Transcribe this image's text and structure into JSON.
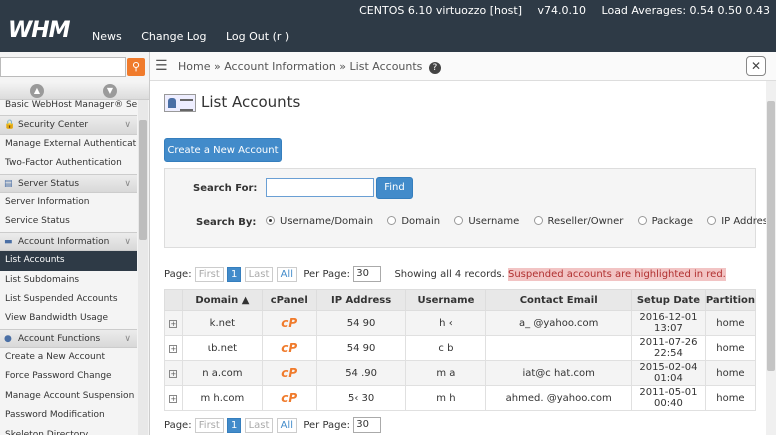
{
  "topbar": {
    "logo": "WHM",
    "nav": [
      "News",
      "Change Log",
      "Log Out (r          )"
    ],
    "server": "CENTOS 6.10 virtuozzo [host]",
    "version": "v74.0.10",
    "load": "Load Averages: 0.54 0.50 0.43"
  },
  "sidebar": {
    "search_placeholder": "",
    "items": [
      {
        "label": "Basic WebHost Manager® Setup",
        "type": "item"
      },
      {
        "label": "Security Center",
        "type": "header",
        "icon": "lock-icon"
      },
      {
        "label": "Manage External Authentications",
        "type": "item"
      },
      {
        "label": "Two-Factor Authentication",
        "type": "item"
      },
      {
        "label": "Server Status",
        "type": "header",
        "icon": "server-icon"
      },
      {
        "label": "Server Information",
        "type": "item"
      },
      {
        "label": "Service Status",
        "type": "item"
      },
      {
        "label": "Account Information",
        "type": "header",
        "icon": "account-icon"
      },
      {
        "label": "List Accounts",
        "type": "item",
        "active": true
      },
      {
        "label": "List Subdomains",
        "type": "item"
      },
      {
        "label": "List Suspended Accounts",
        "type": "item"
      },
      {
        "label": "View Bandwidth Usage",
        "type": "item"
      },
      {
        "label": "Account Functions",
        "type": "header",
        "icon": "users-icon"
      },
      {
        "label": "Create a New Account",
        "type": "item"
      },
      {
        "label": "Force Password Change",
        "type": "item"
      },
      {
        "label": "Manage Account Suspension",
        "type": "item"
      },
      {
        "label": "Password Modification",
        "type": "item"
      },
      {
        "label": "Skeleton Directory",
        "type": "item"
      }
    ]
  },
  "breadcrumb": {
    "home": "Home",
    "section": "Account Information",
    "current": "List Accounts"
  },
  "page": {
    "title": "List Accounts",
    "create_button": "Create a New Account"
  },
  "search": {
    "search_for_label": "Search For:",
    "value": "",
    "find_button": "Find",
    "search_by_label": "Search By:",
    "options": [
      "Username/Domain",
      "Domain",
      "Username",
      "Reseller/Owner",
      "Package",
      "IP Address"
    ],
    "selected": "Username/Domain"
  },
  "pager": {
    "page_label": "Page:",
    "first": "First",
    "current": "1",
    "last": "Last",
    "all": "All",
    "per_page_label": "Per Page:",
    "per_page": "30",
    "showing": "Showing all 4 records.",
    "suspended_note": "Suspended accounts are highlighted in red."
  },
  "table": {
    "columns": [
      "",
      "Domain ▲",
      "cPanel",
      "IP Address",
      "Username",
      "Contact Email",
      "Setup Date",
      "Partition"
    ],
    "rows": [
      {
        "domain": "k.net",
        "ip": "54         90",
        "username": "h    ‹",
        "email": "a_          @yahoo.com",
        "date": "2016-12-01 13:07",
        "partition": "home"
      },
      {
        "domain": "ιb.net",
        "ip": "54         90",
        "username": "c         b",
        "email": "",
        "date": "2011-07-26 22:54",
        "partition": "home"
      },
      {
        "domain": "n         a.com",
        "ip": "54         .90",
        "username": "m         a",
        "email": "       iat@c     hat.com",
        "date": "2015-02-04 01:04",
        "partition": "home"
      },
      {
        "domain": "m          h.com",
        "ip": "5‹         30",
        "username": "m         h",
        "email": "ahmed.                @yahoo.com",
        "date": "2011-05-01 00:40",
        "partition": "home"
      }
    ]
  },
  "colors": {
    "topbar": "#2e3a46",
    "primary": "#428bca",
    "accent": "#f07b2c",
    "suspended": "#f2c4c4"
  }
}
